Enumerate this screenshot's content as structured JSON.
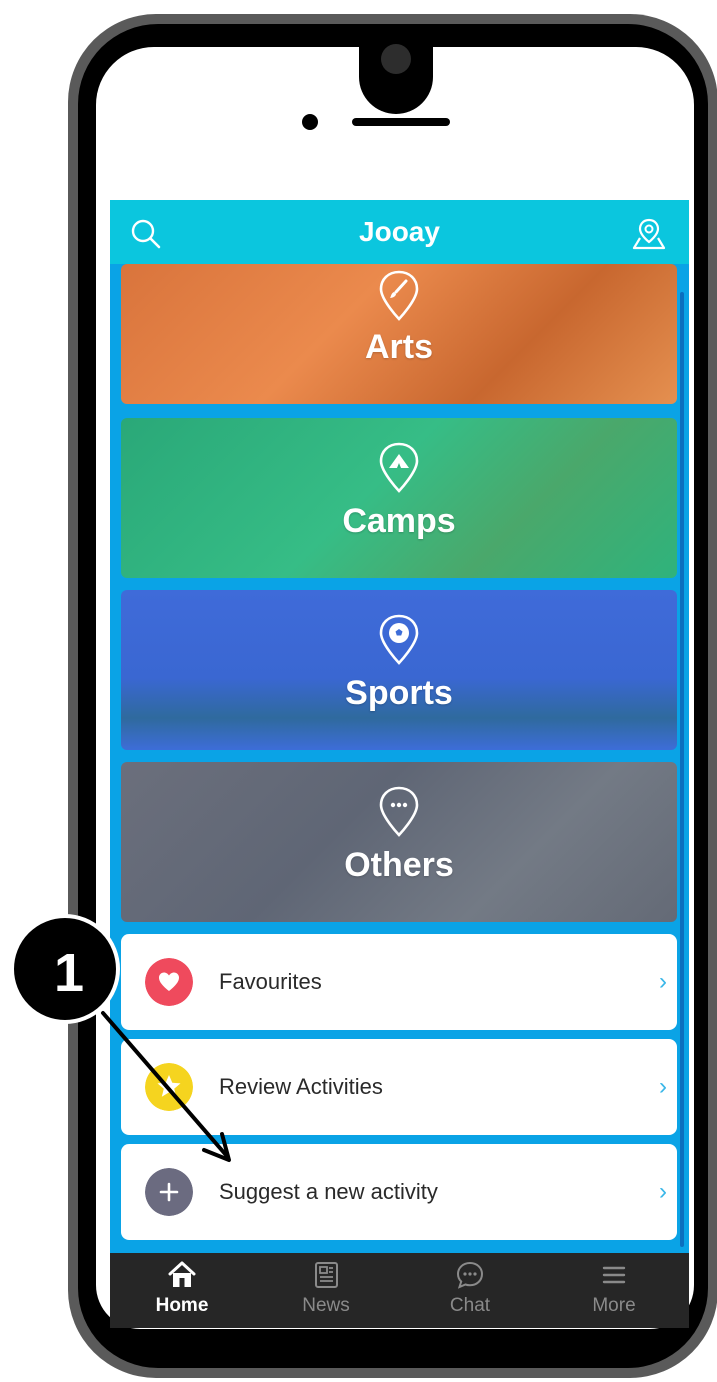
{
  "header": {
    "title": "Jooay",
    "left_icon": "search-icon",
    "right_icon": "map-location-icon"
  },
  "categories": [
    {
      "label": "Arts",
      "icon": "paintbrush-pin-icon",
      "color": "#e87f45"
    },
    {
      "label": "Camps",
      "icon": "tent-pin-icon",
      "color": "#2fb37c"
    },
    {
      "label": "Sports",
      "icon": "soccer-ball-pin-icon",
      "color": "#3d6dd8"
    },
    {
      "label": "Others",
      "icon": "ellipsis-pin-icon",
      "color": "#6a6f7e"
    }
  ],
  "list": [
    {
      "label": "Favourites",
      "icon": "heart-icon",
      "icon_color": "#ef4a5d"
    },
    {
      "label": "Review Activities",
      "icon": "star-icon",
      "icon_color": "#f5d41f"
    },
    {
      "label": "Suggest a new activity",
      "icon": "plus-icon",
      "icon_color": "#6b6b80"
    }
  ],
  "tabs": [
    {
      "label": "Home",
      "icon": "home-icon",
      "active": true
    },
    {
      "label": "News",
      "icon": "newspaper-icon",
      "active": false
    },
    {
      "label": "Chat",
      "icon": "chat-bubble-icon",
      "active": false
    },
    {
      "label": "More",
      "icon": "menu-icon",
      "active": false
    }
  ],
  "annotation": {
    "number": "1"
  },
  "colors": {
    "header": "#0bc6de",
    "background": "#0aa3e6",
    "tabbar": "#262626",
    "chevron": "#3ab7e8"
  }
}
